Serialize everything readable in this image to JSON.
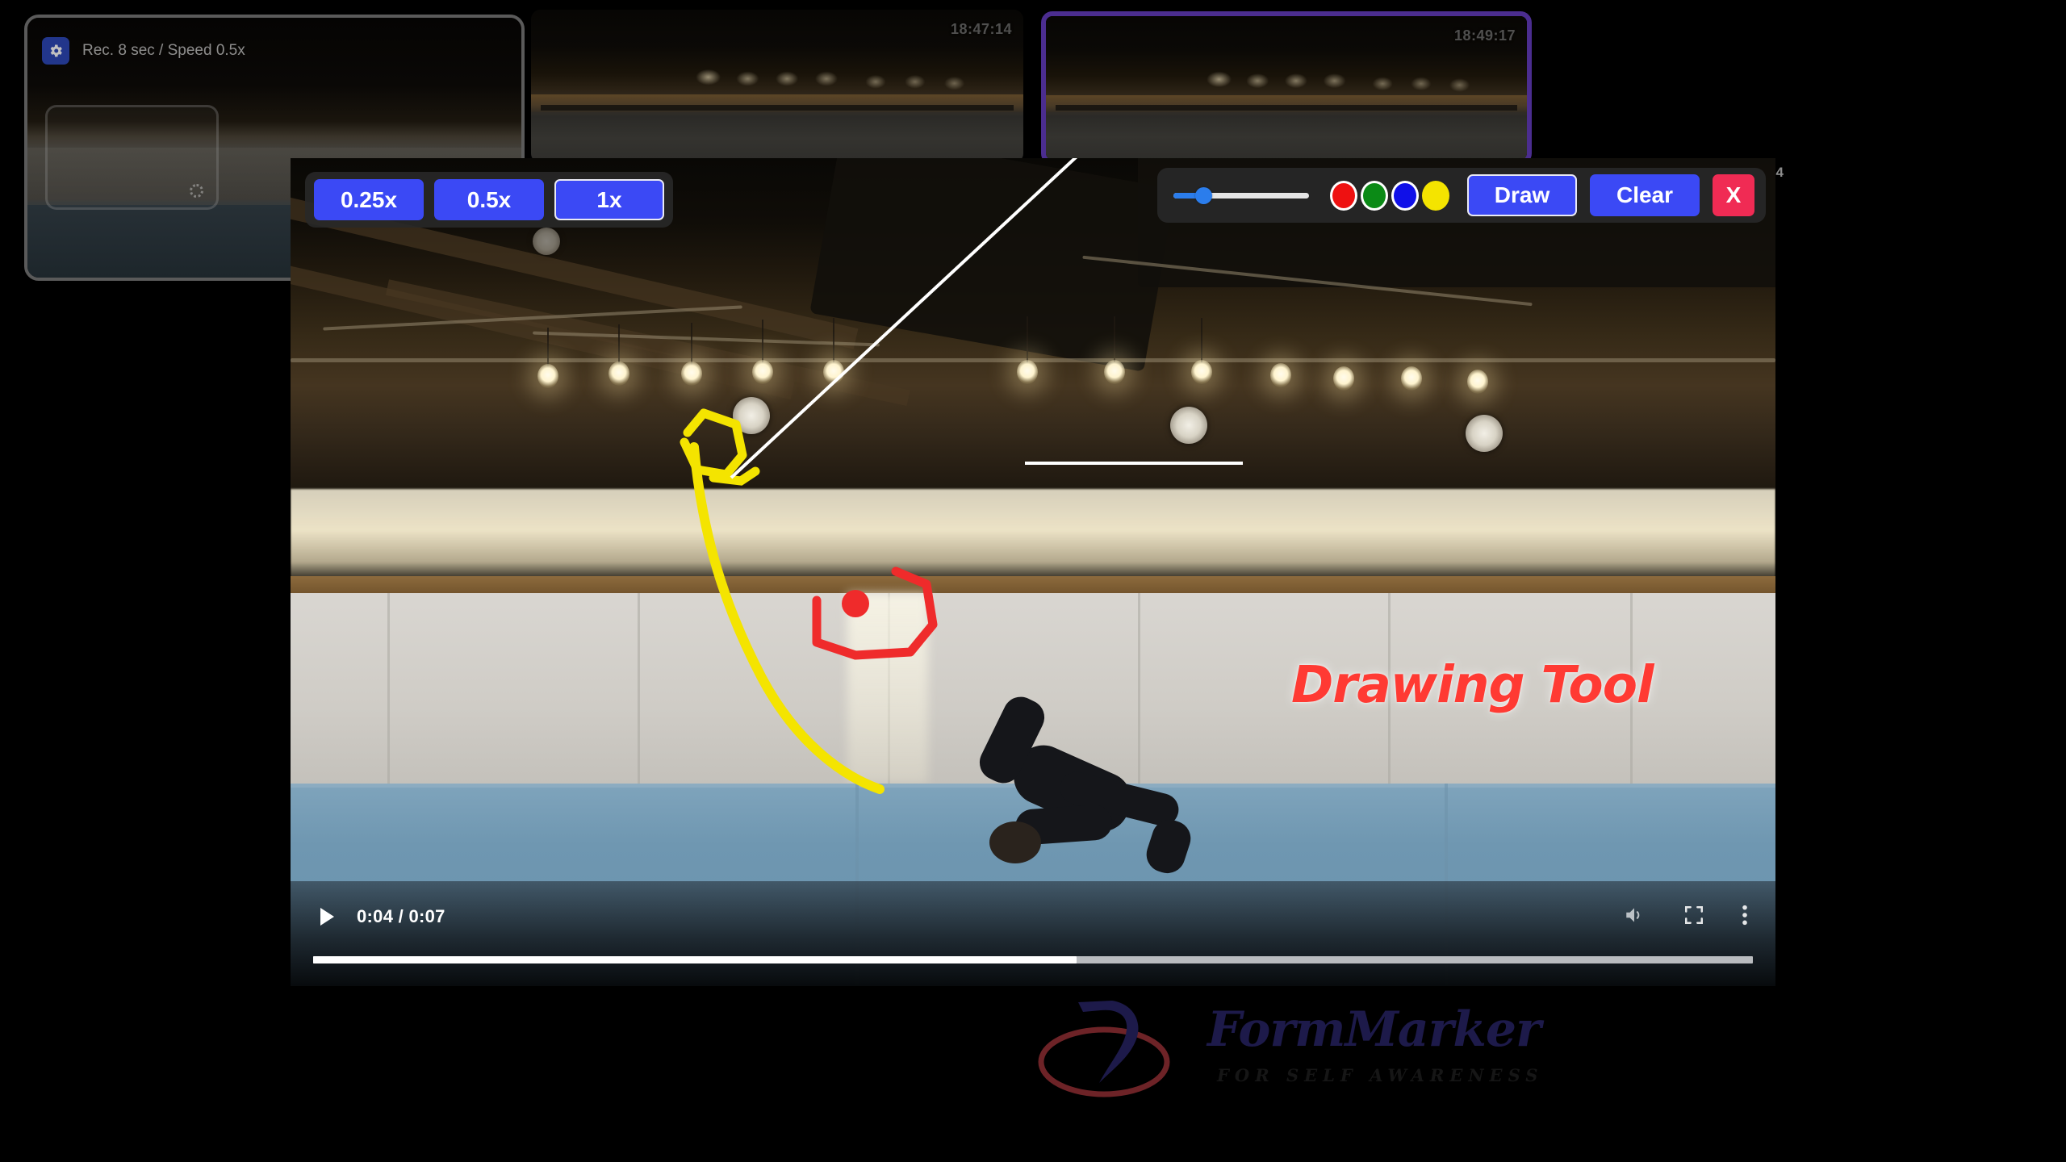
{
  "app": {
    "brand_name_1": "Form",
    "brand_name_2": "M",
    "brand_name_3": "arker",
    "brand_tagline": "FOR SELF AWARENESS"
  },
  "recorder": {
    "gear_icon": "gear-icon",
    "status_label": "Rec. 8 sec / Speed 0.5x",
    "spinner_icon": "loading-spinner-icon"
  },
  "thumbnails": [
    {
      "timestamp": "",
      "selected": false
    },
    {
      "timestamp": "18:47:14",
      "selected": false
    },
    {
      "timestamp": "18:49:17",
      "selected": true
    }
  ],
  "speed_toolbar": {
    "buttons": [
      {
        "label": "0.25x",
        "active": false
      },
      {
        "label": "0.5x",
        "active": false
      },
      {
        "label": "1x",
        "active": true
      }
    ]
  },
  "draw_toolbar": {
    "stroke_slider": {
      "name": "stroke-width-slider",
      "value_percent": 22
    },
    "colors": [
      {
        "name": "red",
        "hex": "#ee1111",
        "selected": true
      },
      {
        "name": "green",
        "hex": "#0b8a16",
        "selected": true
      },
      {
        "name": "blue",
        "hex": "#1010e8",
        "selected": true
      },
      {
        "name": "yellow",
        "hex": "#f4e400",
        "selected": false
      }
    ],
    "draw_label": "Draw",
    "draw_active": true,
    "clear_label": "Clear",
    "close_label": "X",
    "corner_badge": "4"
  },
  "overlay": {
    "title_text": "Drawing Tool"
  },
  "player": {
    "play_icon": "play-icon",
    "time_current": "0:04",
    "time_separator": "/",
    "time_total": "0:07",
    "time_display": "0:04 / 0:07",
    "volume_icon": "volume-icon",
    "fullscreen_icon": "fullscreen-icon",
    "more_icon": "more-options-icon",
    "progress_percent": 53,
    "buffered_percent": 100
  },
  "annotations": [
    {
      "shape": "hexagon",
      "color": "#f4e400",
      "name": "yellow-hexagon-mark"
    },
    {
      "shape": "curve",
      "color": "#f4e400",
      "name": "yellow-trajectory-line"
    },
    {
      "shape": "dot",
      "color": "#ef2b2b",
      "name": "red-point-mark"
    },
    {
      "shape": "polygon",
      "color": "#ef2b2b",
      "name": "red-polygon-mark"
    },
    {
      "shape": "line",
      "color": "#ffffff",
      "name": "white-pointer-line"
    },
    {
      "shape": "underline",
      "color": "#ffffff",
      "name": "white-underline"
    }
  ]
}
